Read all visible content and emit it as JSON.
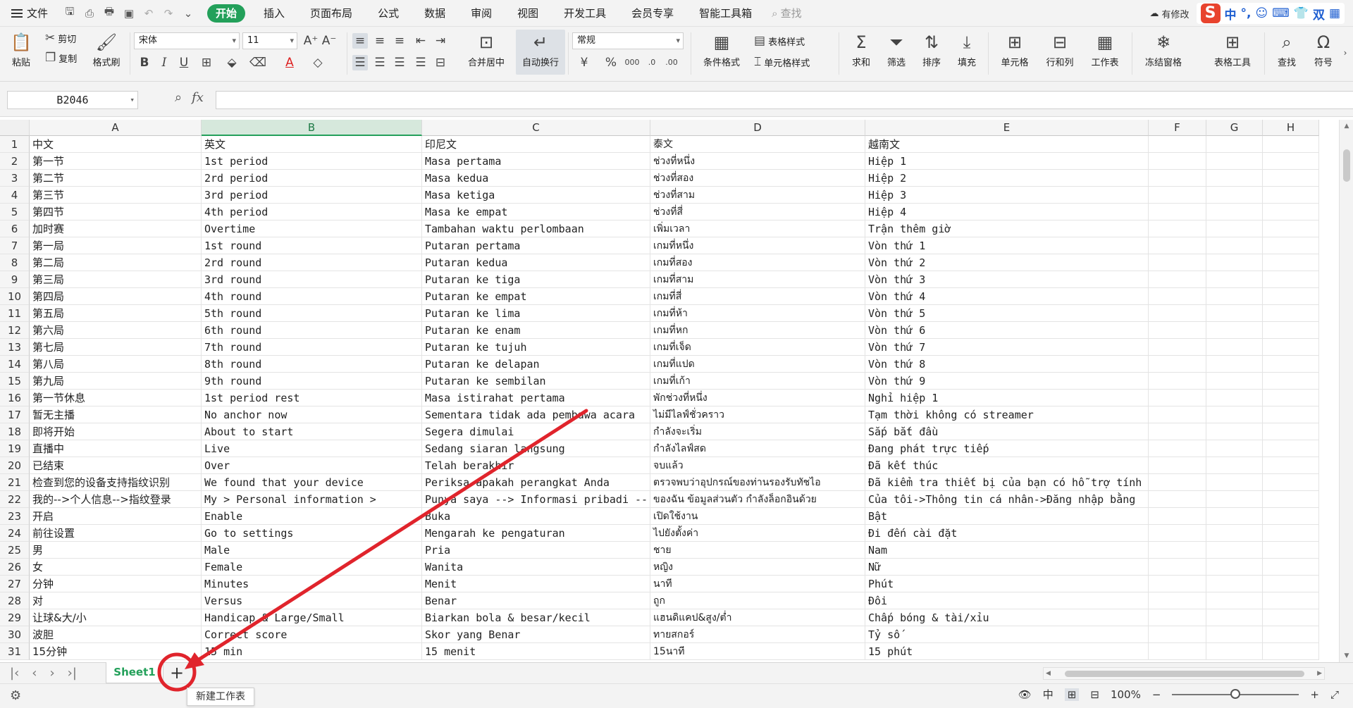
{
  "menubar": {
    "file_label": "文件",
    "tabs": [
      "开始",
      "插入",
      "页面布局",
      "公式",
      "数据",
      "审阅",
      "视图",
      "开发工具",
      "会员专享",
      "智能工具箱"
    ],
    "active_tab": "开始",
    "search_label": "查找",
    "cloud_label": "有修改",
    "ime_labels": [
      "中",
      "°,",
      "双"
    ]
  },
  "ribbon": {
    "paste": "粘贴",
    "cut": "剪切",
    "copy": "复制",
    "format_painter": "格式刷",
    "font_name": "宋体",
    "font_size": "11",
    "merge_center": "合并居中",
    "wrap_text": "自动换行",
    "number_format": "常规",
    "conditional_format": "条件格式",
    "table_style": "表格样式",
    "cell_style": "单元格样式",
    "sum": "求和",
    "filter": "筛选",
    "sort": "排序",
    "fill": "填充",
    "cell": "单元格",
    "row_col": "行和列",
    "worksheet": "工作表",
    "freeze": "冻结窗格",
    "table_tools": "表格工具",
    "find": "查找",
    "symbol": "符号",
    "bold": "B",
    "italic": "I",
    "underline": "U"
  },
  "formula_bar": {
    "name_box": "B2046",
    "fx_label": "fx",
    "formula": ""
  },
  "columns": [
    "A",
    "B",
    "C",
    "D",
    "E",
    "F",
    "G",
    "H"
  ],
  "selected_column": "B",
  "rows": [
    {
      "n": "1",
      "a": "中文",
      "b": "英文",
      "c": "印尼文",
      "d": "泰文",
      "e": "越南文"
    },
    {
      "n": "2",
      "a": "第一节",
      "b": "1st period",
      "c": "Masa pertama",
      "d": "ช่วงที่หนึ่ง",
      "e": "Hiệp 1"
    },
    {
      "n": "3",
      "a": "第二节",
      "b": "2rd period",
      "c": "Masa kedua",
      "d": "ช่วงที่สอง",
      "e": "Hiệp 2"
    },
    {
      "n": "4",
      "a": "第三节",
      "b": "3rd period",
      "c": "Masa ketiga",
      "d": "ช่วงที่สาม",
      "e": "Hiệp 3"
    },
    {
      "n": "5",
      "a": "第四节",
      "b": "4th period",
      "c": "Masa ke empat",
      "d": "ช่วงที่สี่",
      "e": "Hiệp 4"
    },
    {
      "n": "6",
      "a": "加时赛",
      "b": "Overtime",
      "c": "Tambahan waktu perlombaan",
      "d": "เพิ่มเวลา",
      "e": "Trận thêm giờ"
    },
    {
      "n": "7",
      "a": "第一局",
      "b": "1st round",
      "c": "Putaran pertama",
      "d": "เกมที่หนึ่ง",
      "e": "Vòn thứ 1"
    },
    {
      "n": "8",
      "a": "第二局",
      "b": "2rd round",
      "c": "Putaran kedua",
      "d": "เกมที่สอง",
      "e": "Vòn thứ 2"
    },
    {
      "n": "9",
      "a": "第三局",
      "b": "3rd round",
      "c": "Putaran ke tiga",
      "d": "เกมที่สาม",
      "e": "Vòn thứ 3"
    },
    {
      "n": "10",
      "a": "第四局",
      "b": "4th round",
      "c": "Putaran ke empat",
      "d": "เกมที่สี่",
      "e": "Vòn thứ 4"
    },
    {
      "n": "11",
      "a": "第五局",
      "b": "5th round",
      "c": "Putaran ke lima",
      "d": "เกมที่ห้า",
      "e": "Vòn thứ 5"
    },
    {
      "n": "12",
      "a": "第六局",
      "b": "6th round",
      "c": "Putaran ke enam",
      "d": "เกมที่หก",
      "e": "Vòn thứ 6"
    },
    {
      "n": "13",
      "a": "第七局",
      "b": "7th round",
      "c": "Putaran ke tujuh",
      "d": "เกมที่เจ็ด",
      "e": "Vòn thứ 7"
    },
    {
      "n": "14",
      "a": "第八局",
      "b": "8th round",
      "c": "Putaran ke delapan",
      "d": "เกมที่แปด",
      "e": "Vòn thứ 8"
    },
    {
      "n": "15",
      "a": "第九局",
      "b": "9th round",
      "c": "Putaran ke sembilan",
      "d": "เกมที่เก้า",
      "e": "Vòn thứ 9"
    },
    {
      "n": "16",
      "a": "第一节休息",
      "b": "1st period rest",
      "c": "Masa istirahat pertama",
      "d": "พักช่วงที่หนึ่ง",
      "e": "Nghỉ hiệp 1"
    },
    {
      "n": "17",
      "a": "暂无主播",
      "b": "No anchor now",
      "c": "Sementara tidak ada pembawa acara",
      "d": "ไม่มีไลฟ์ชั่วคราว",
      "e": "Tạm thời không có streamer"
    },
    {
      "n": "18",
      "a": "即将开始",
      "b": "About to start",
      "c": "Segera dimulai",
      "d": "กำลังจะเริ่ม",
      "e": "Sắp bắt đầu"
    },
    {
      "n": "19",
      "a": "直播中",
      "b": "Live",
      "c": "Sedang siaran langsung",
      "d": "กำลังไลฟ์สด",
      "e": "Đang phát trực tiếp"
    },
    {
      "n": "20",
      "a": "已结束",
      "b": "Over",
      "c": "Telah berakhir",
      "d": "จบแล้ว",
      "e": "Đã kết thúc"
    },
    {
      "n": "21",
      "a": "检查到您的设备支持指纹识别",
      "b": "We found that your device",
      "c": "Periksa apakah perangkat Anda",
      "d": "ตรวจพบว่าอุปกรณ์ของท่านรองรับทัชไอ",
      "e": "Đã kiểm tra thiết bị của bạn có hỗ trợ tính"
    },
    {
      "n": "22",
      "a": "我的-->个人信息-->指纹登录",
      "b": "My > Personal information >",
      "c": "Punya saya --> Informasi pribadi --",
      "d": "ของฉัน ข้อมูลส่วนตัว กำลังล็อกอินด้วย",
      "e": "Của tôi->Thông tin cá nhân->Đăng nhập bằng"
    },
    {
      "n": "23",
      "a": "开启",
      "b": "Enable",
      "c": "Buka",
      "d": "เปิดใช้งาน",
      "e": "Bật"
    },
    {
      "n": "24",
      "a": "前往设置",
      "b": "Go to settings",
      "c": "Mengarah ke pengaturan",
      "d": "ไปยังตั้งค่า",
      "e": "Đi đến cài đặt"
    },
    {
      "n": "25",
      "a": "男",
      "b": "Male",
      "c": "Pria",
      "d": "ชาย",
      "e": "Nam"
    },
    {
      "n": "26",
      "a": "女",
      "b": "Female",
      "c": "Wanita",
      "d": "หญิง",
      "e": "Nữ"
    },
    {
      "n": "27",
      "a": "分钟",
      "b": "Minutes",
      "c": "Menit",
      "d": "นาที",
      "e": "Phút"
    },
    {
      "n": "28",
      "a": "对",
      "b": "Versus",
      "c": "Benar",
      "d": "ถูก",
      "e": "Đôi"
    },
    {
      "n": "29",
      "a": "让球&大/小",
      "b": "Handicap & Large/Small",
      "c": "Biarkan bola & besar/kecil",
      "d": "แฮนดิแคป&สูง/ต่ำ",
      "e": "Chấp bóng & tài/xỉu"
    },
    {
      "n": "30",
      "a": "波胆",
      "b": "Correct score",
      "c": "Skor yang Benar",
      "d": "ทายสกอร์",
      "e": "Tỷ số"
    },
    {
      "n": "31",
      "a": "15分钟",
      "b": "15 min",
      "c": "15 menit",
      "d": "15นาที",
      "e": "15 phút"
    }
  ],
  "sheet_tabs": [
    "Sheet1"
  ],
  "tooltip": "新建工作表",
  "status": {
    "zoom": "100%",
    "zoom_fraction": 0.5,
    "lang": "中"
  },
  "colors": {
    "accent": "#23a05a",
    "annotation": "#e0242c"
  }
}
